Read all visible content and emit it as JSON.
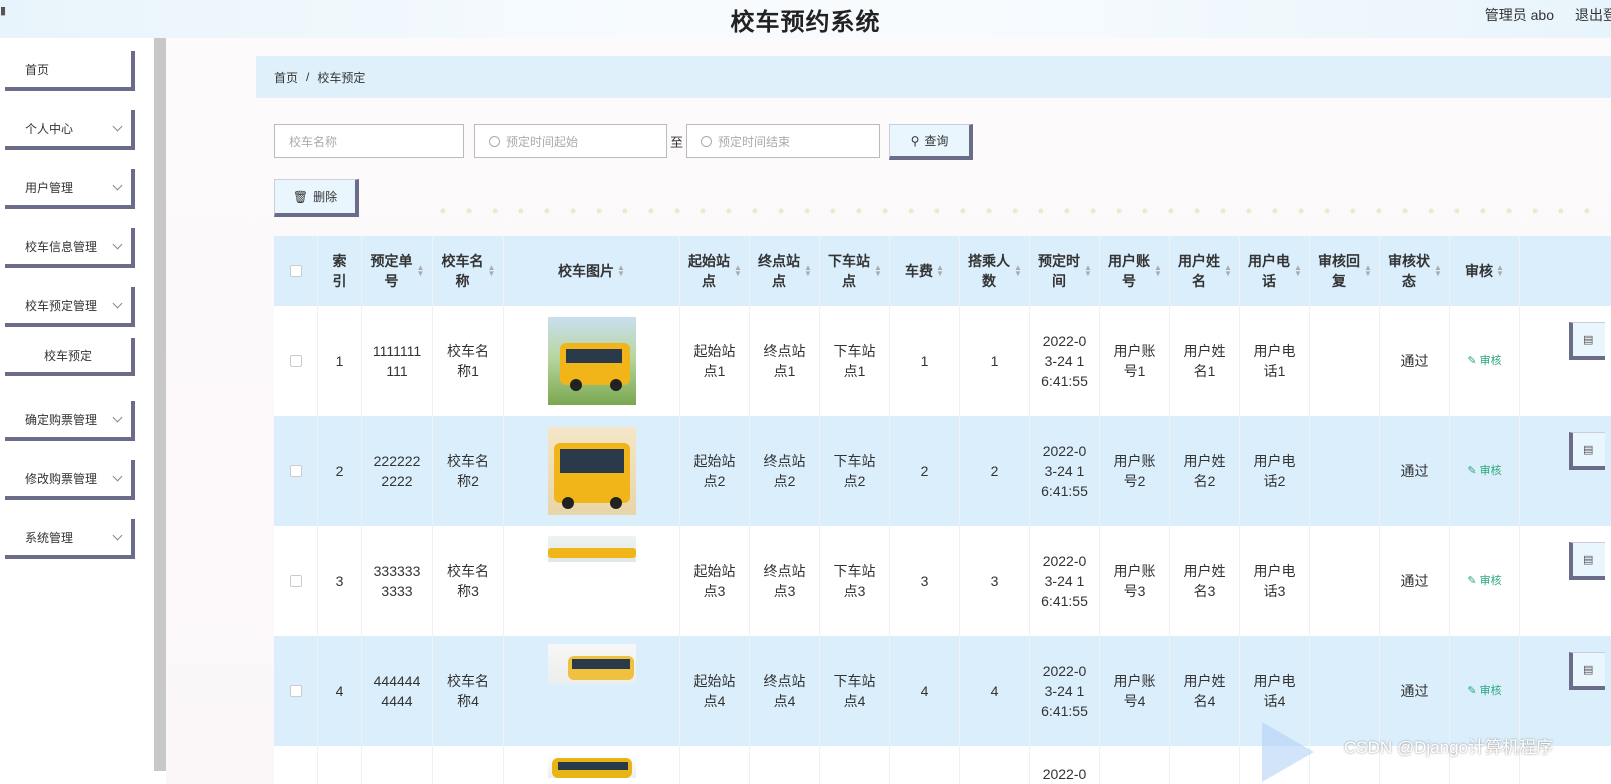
{
  "header": {
    "title": "校车预约系统",
    "admin_label": "管理员 abo",
    "logout_label": "退出登录"
  },
  "sidebar": {
    "items": [
      {
        "label": "首页",
        "has_children": false
      },
      {
        "label": "个人中心",
        "has_children": true
      },
      {
        "label": "用户管理",
        "has_children": true
      },
      {
        "label": "校车信息管理",
        "has_children": true
      },
      {
        "label": "校车预定管理",
        "has_children": true
      },
      {
        "label": "确定购票管理",
        "has_children": true
      },
      {
        "label": "修改购票管理",
        "has_children": true
      },
      {
        "label": "系统管理",
        "has_children": true
      }
    ],
    "active_subitem": "校车预定"
  },
  "breadcrumb": {
    "home": "首页",
    "separator": "/",
    "current": "校车预定"
  },
  "search": {
    "name_placeholder": "校车名称",
    "start_placeholder": "预定时间起始",
    "to_label": "至",
    "end_placeholder": "预定时间结束",
    "query_label": "查询",
    "delete_label": "删除"
  },
  "table": {
    "columns": [
      "索引",
      "预定单号",
      "校车名称",
      "校车图片",
      "起始站点",
      "终点站点",
      "下车站点",
      "车费",
      "搭乘人数",
      "预定时间",
      "用户账号",
      "用户姓名",
      "用户电话",
      "审核回复",
      "审核状态",
      "审核"
    ],
    "rows": [
      {
        "index": "1",
        "order_no": "1111111111",
        "bus_name": "校车名称1",
        "start": "起始站点1",
        "end": "终点站点1",
        "drop": "下车站点1",
        "fare": "1",
        "riders": "1",
        "time": "2022-03-24 16:41:55",
        "account": "用户账号1",
        "user_name": "用户姓名1",
        "phone": "用户电话1",
        "reply": "",
        "status": "通过",
        "audit": "审核"
      },
      {
        "index": "2",
        "order_no": "2222222222",
        "bus_name": "校车名称2",
        "start": "起始站点2",
        "end": "终点站点2",
        "drop": "下车站点2",
        "fare": "2",
        "riders": "2",
        "time": "2022-03-24 16:41:55",
        "account": "用户账号2",
        "user_name": "用户姓名2",
        "phone": "用户电话2",
        "reply": "",
        "status": "通过",
        "audit": "审核"
      },
      {
        "index": "3",
        "order_no": "3333333333",
        "bus_name": "校车名称3",
        "start": "起始站点3",
        "end": "终点站点3",
        "drop": "下车站点3",
        "fare": "3",
        "riders": "3",
        "time": "2022-03-24 16:41:55",
        "account": "用户账号3",
        "user_name": "用户姓名3",
        "phone": "用户电话3",
        "reply": "",
        "status": "通过",
        "audit": "审核"
      },
      {
        "index": "4",
        "order_no": "4444444444",
        "bus_name": "校车名称4",
        "start": "起始站点4",
        "end": "终点站点4",
        "drop": "下车站点4",
        "fare": "4",
        "riders": "4",
        "time": "2022-03-24 16:41:55",
        "account": "用户账号4",
        "user_name": "用户姓名4",
        "phone": "用户电话4",
        "reply": "",
        "status": "通过",
        "audit": "审核"
      }
    ],
    "partial_row_time": "2022-0"
  },
  "watermark": "CSDN @Django计算机程序",
  "colors": {
    "header_bg": "#daeefc",
    "stripe_bg": "#daeefc",
    "button_border": "#6b6b8a",
    "audit_green": "#2aa87a"
  }
}
